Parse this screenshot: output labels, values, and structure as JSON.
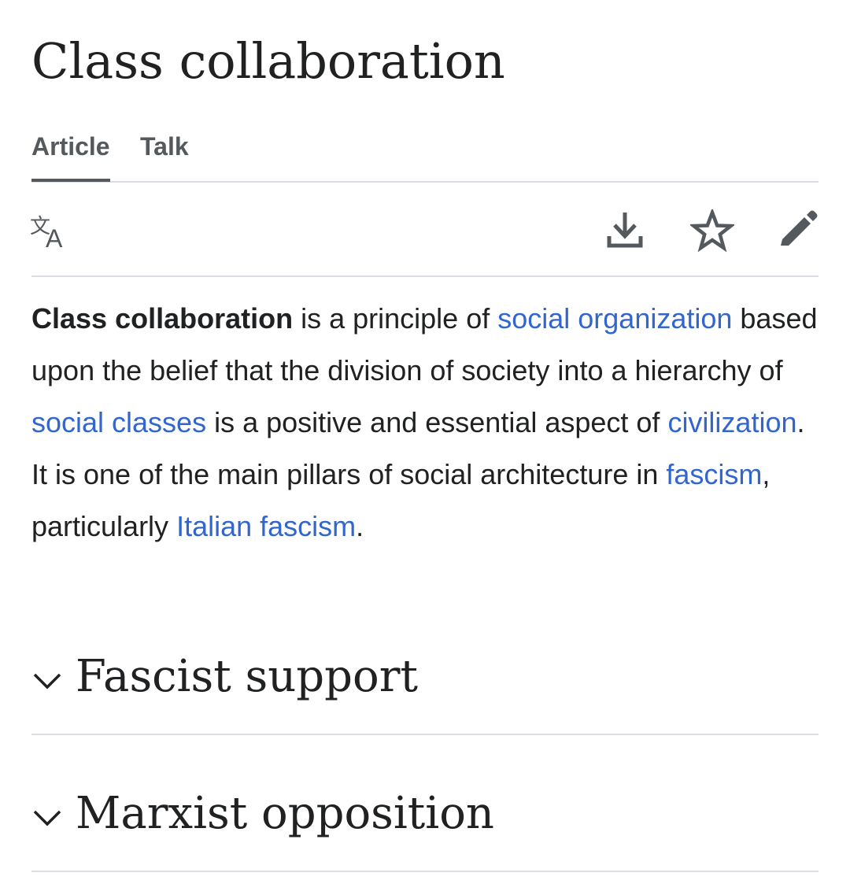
{
  "page": {
    "title": "Class collaboration"
  },
  "tabs": [
    {
      "label": "Article",
      "selected": true
    },
    {
      "label": "Talk",
      "selected": false
    }
  ],
  "toolbar": {
    "icons": [
      "language-icon",
      "download-icon",
      "star-icon",
      "edit-pencil-icon"
    ]
  },
  "lead": {
    "bold": "Class collaboration",
    "t1": " is a principle of ",
    "link1": "social organization",
    "t2": " based upon the belief that the division of society into a hierarchy of ",
    "link2": "social classes",
    "t3": " is a positive and essential aspect of ",
    "link3": "civilization",
    "t4": ". It is one of the main pillars of social architecture in ",
    "link4": "fascism",
    "t5": ", particularly ",
    "link5": "Italian fascism",
    "t6": "."
  },
  "sections": [
    {
      "title": "Fascist support",
      "icon": "chevron-down-icon"
    },
    {
      "title": "Marxist opposition",
      "icon": "chevron-down-icon"
    }
  ],
  "colors": {
    "text": "#202122",
    "link": "#3366cc",
    "muted": "#54595d",
    "divider": "#dadde3"
  }
}
